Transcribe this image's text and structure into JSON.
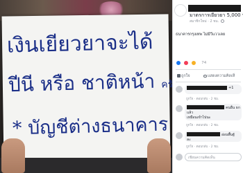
{
  "photo": {
    "line1": "เงินเยียวยาจะได้",
    "line2_main": "ปีนี หรือ ชาติหน้า",
    "line2_small": "ครับ",
    "line3": "* บัญชีต่างธนาคาร ..."
  },
  "post": {
    "title": "มาตรการเยียวยา 5,000 บ",
    "meta": "สมาชิกใหม่ · 2 ชม.",
    "text": "ธนาคารกรุงเทพ ไม่มีวีแววเลย",
    "reaction_count": "74",
    "like_label": "ถูกใจ",
    "comment_label": "แสดงความคิดเห็"
  },
  "comments": [
    {
      "text": "+1",
      "links": "ถูกใจ · ตอบกลับ · 2 ชม."
    },
    {
      "text": "คนอื่น ธก",
      "text2": "แล้ว",
      "text3": "เหมือนเข้าไปนะ",
      "links": "ถูกใจ · ตอบกลับ · 2 ชม."
    },
    {
      "text": "อ่อนพื้นฐั",
      "text2": "ละ",
      "links": "ถูกใจ · ตอบกลับ · 2 ชม."
    }
  ],
  "write_placeholder": "เขียนความคิดเห็น"
}
